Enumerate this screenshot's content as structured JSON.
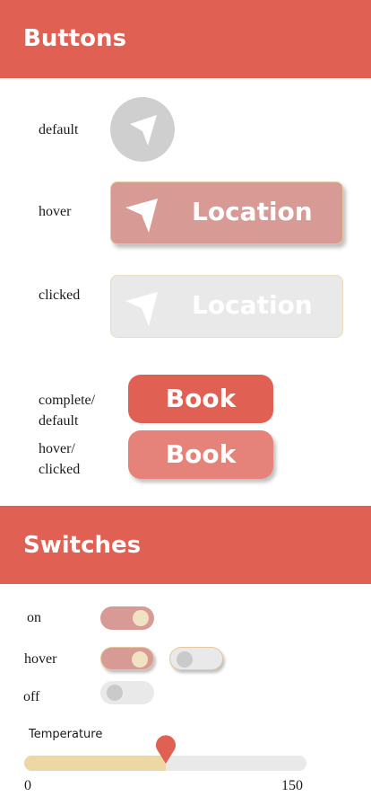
{
  "buttons_section": {
    "title": "Buttons",
    "states": {
      "default": "default",
      "hover": "hover",
      "clicked": "clicked",
      "complete_default_1": "complete/",
      "complete_default_2": "default",
      "hover_clicked_1": "hover/",
      "hover_clicked_2": "clicked"
    },
    "location_label": "Location",
    "book_label": "Book",
    "icon": "navigation-arrow-icon"
  },
  "switches_section": {
    "title": "Switches",
    "states": {
      "on": "on",
      "hover": "hover",
      "off": "off"
    },
    "toggles": {
      "on": true,
      "hover_on": true,
      "hover_off": false,
      "off": false
    }
  },
  "slider": {
    "label": "Temperature",
    "min": 0,
    "max": 150,
    "min_label": "0",
    "max_label": "150",
    "value_fraction": 0.5
  },
  "colors": {
    "header": "#e06153",
    "hover_button": "#d89a95",
    "disabled": "#e9e9e9",
    "knob_on": "#f1e2c4",
    "slider_fill": "#ecd7a5"
  }
}
